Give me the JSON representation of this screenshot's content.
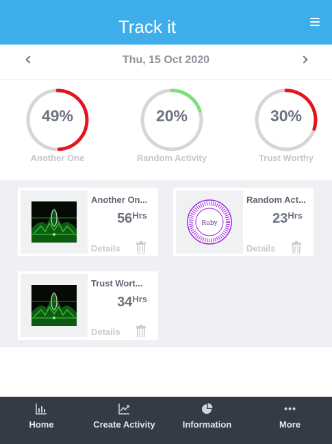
{
  "header": {
    "title": "Track it",
    "menu_icon": "hamburger-menu-icon"
  },
  "datebar": {
    "date": "Thu, 15 Oct 2020"
  },
  "gauges": [
    {
      "percent": 0.49,
      "label_pct": "49%",
      "label": "Another One",
      "color": "#e8141d"
    },
    {
      "percent": 0.2,
      "label_pct": "20%",
      "label": "Random Activity",
      "color": "#7de07a"
    },
    {
      "percent": 0.3,
      "label_pct": "30%",
      "label": "Trust Worthy",
      "color": "#e8141d"
    }
  ],
  "cards": [
    {
      "name": "Another On...",
      "hours": "56",
      "unit": "Hrs",
      "details": "Details",
      "thumb": "dark-green-art"
    },
    {
      "name": "Random Act...",
      "hours": "23",
      "unit": "Hrs",
      "details": "Details",
      "thumb": "ruby-logo",
      "thumb_text": "Ruby"
    },
    {
      "name": "Trust Wort...",
      "hours": "34",
      "unit": "Hrs",
      "details": "Details",
      "thumb": "dark-green-art"
    }
  ],
  "nav": [
    {
      "label": "Home",
      "icon": "bar-chart-icon"
    },
    {
      "label": "Create Activity",
      "icon": "line-chart-icon"
    },
    {
      "label": "Information",
      "icon": "pie-chart-icon"
    },
    {
      "label": "More",
      "icon": "more-dots-icon"
    }
  ],
  "colors": {
    "header": "#3daee9",
    "nav": "#343a46",
    "track": "#d6d6d6"
  }
}
